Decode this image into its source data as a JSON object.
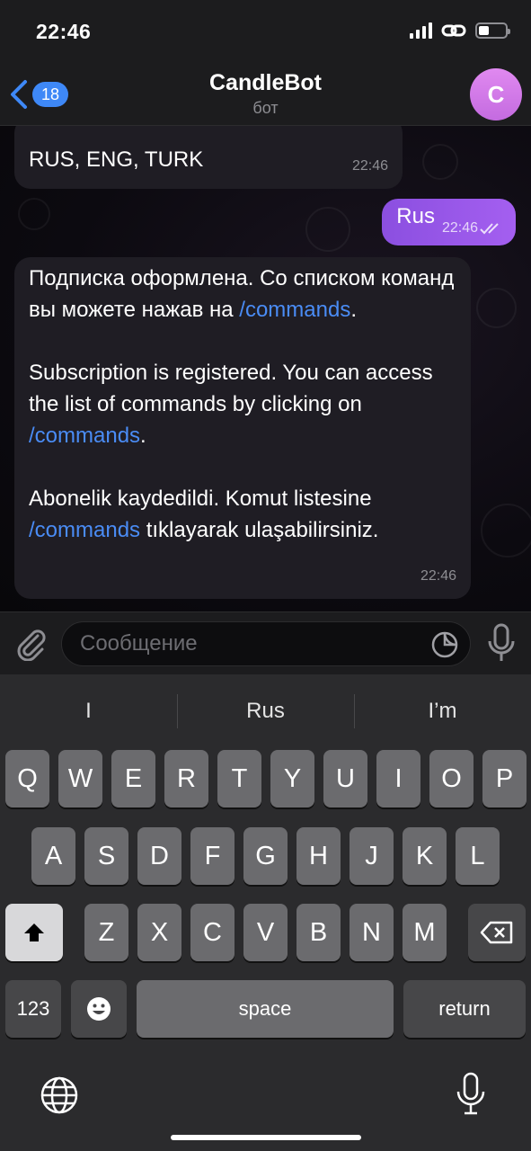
{
  "status": {
    "time": "22:46"
  },
  "header": {
    "back_count": "18",
    "title": "CandleBot",
    "subtitle": "бот",
    "avatar_letter": "C"
  },
  "messages": {
    "top": {
      "text": "RUS, ENG, TURK",
      "time": "22:46"
    },
    "outgoing": {
      "text": "Rus",
      "time": "22:46"
    },
    "main": {
      "ru_text": "Подписка оформлена. Со списком команд вы можете нажав на ",
      "ru_link": "/commands",
      "ru_end": ".",
      "en_text": "Subscription is registered. You can access the list of commands by clicking on ",
      "en_link": "/commands",
      "en_end": ".",
      "tr_text": "Abonelik kaydedildi. Komut listesine ",
      "tr_link": "/commands",
      "tr_end": " tıklayarak ulaşabilirsiniz.",
      "time": "22:46"
    }
  },
  "input": {
    "placeholder": "Сообщение"
  },
  "keyboard": {
    "suggestions": [
      "I",
      "Rus",
      "I’m"
    ],
    "row1": [
      "Q",
      "W",
      "E",
      "R",
      "T",
      "Y",
      "U",
      "I",
      "O",
      "P"
    ],
    "row2": [
      "A",
      "S",
      "D",
      "F",
      "G",
      "H",
      "J",
      "K",
      "L"
    ],
    "row3": [
      "Z",
      "X",
      "C",
      "V",
      "B",
      "N",
      "M"
    ],
    "numbers_label": "123",
    "space_label": "space",
    "return_label": "return"
  },
  "colors": {
    "accent": "#3e88f7",
    "outgoing_bubble": "#9b57ea",
    "link": "#4a8cf5"
  }
}
